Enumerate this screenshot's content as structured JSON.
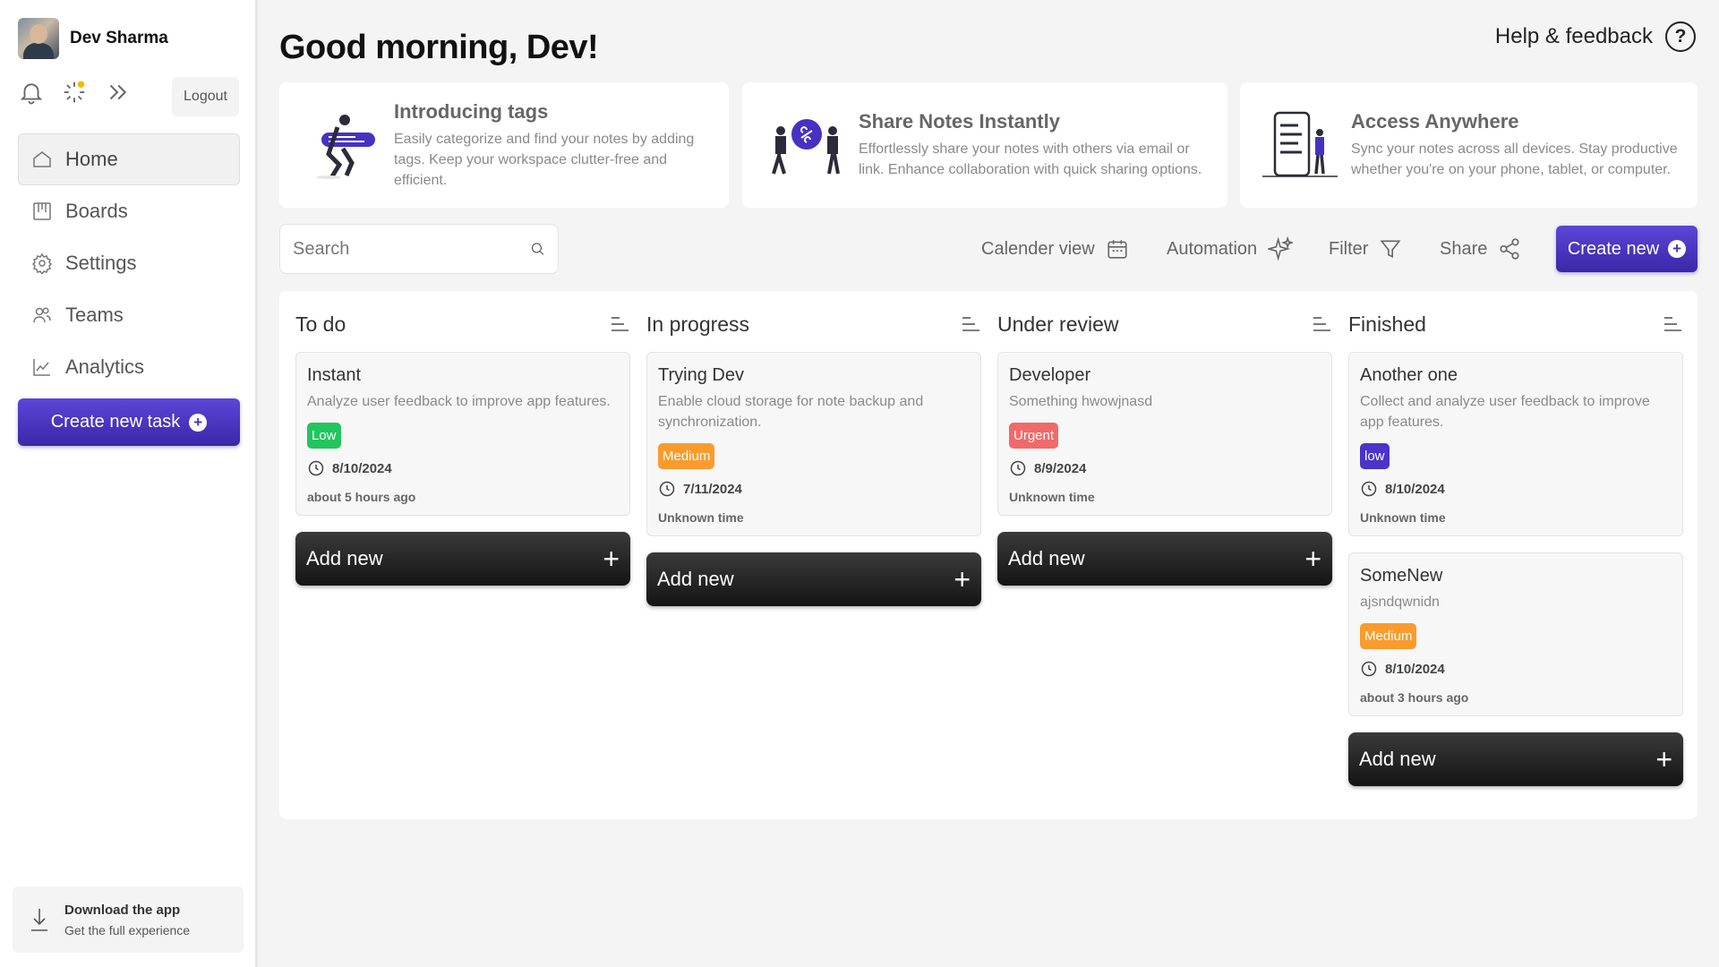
{
  "user": {
    "name": "Dev Sharma"
  },
  "sidebar": {
    "logout_label": "Logout",
    "nav": [
      {
        "label": "Home",
        "icon": "home-icon",
        "active": true
      },
      {
        "label": "Boards",
        "icon": "boards-icon"
      },
      {
        "label": "Settings",
        "icon": "settings-icon"
      },
      {
        "label": "Teams",
        "icon": "teams-icon"
      },
      {
        "label": "Analytics",
        "icon": "analytics-icon"
      }
    ],
    "create_task_label": "Create new task",
    "download": {
      "title": "Download the app",
      "subtitle": "Get the full experience"
    }
  },
  "header": {
    "greeting": "Good morning, Dev!",
    "help_label": "Help & feedback"
  },
  "info_cards": [
    {
      "title": "Introducing tags",
      "desc": "Easily categorize and find your notes by adding tags. Keep your workspace clutter-free and efficient."
    },
    {
      "title": "Share Notes Instantly",
      "desc": "Effortlessly share your notes with others via email or link. Enhance collaboration with quick sharing options."
    },
    {
      "title": "Access Anywhere",
      "desc": "Sync your notes across all devices. Stay productive whether you're on your phone, tablet, or computer."
    }
  ],
  "toolbar": {
    "search_placeholder": "Search",
    "calendar_label": "Calender view",
    "automation_label": "Automation",
    "filter_label": "Filter",
    "share_label": "Share",
    "create_new_label": "Create new"
  },
  "board": {
    "add_new_label": "Add new",
    "columns": [
      {
        "title": "To do",
        "cards": [
          {
            "title": "Instant",
            "desc": "Analyze user feedback to improve app features.",
            "priority": "Low",
            "priority_class": "low",
            "date": "8/10/2024",
            "ago": "about 5 hours ago"
          }
        ]
      },
      {
        "title": "In progress",
        "cards": [
          {
            "title": "Trying Dev",
            "desc": "Enable cloud storage for note backup and synchronization.",
            "priority": "Medium",
            "priority_class": "medium",
            "date": "7/11/2024",
            "ago": "Unknown time"
          }
        ]
      },
      {
        "title": "Under review",
        "cards": [
          {
            "title": "Developer",
            "desc": "Something hwowjnasd",
            "priority": "Urgent",
            "priority_class": "urgent",
            "date": "8/9/2024",
            "ago": "Unknown time"
          }
        ]
      },
      {
        "title": "Finished",
        "cards": [
          {
            "title": "Another one",
            "desc": "Collect and analyze user feedback to improve app features.",
            "priority": "low",
            "priority_class": "lowp",
            "date": "8/10/2024",
            "ago": "Unknown time"
          },
          {
            "title": "SomeNew",
            "desc": "ajsndqwnidn",
            "priority": "Medium",
            "priority_class": "medium",
            "date": "8/10/2024",
            "ago": "about 3 hours ago"
          }
        ]
      }
    ]
  },
  "colors": {
    "accent": "#4632c2",
    "low": "#22c55e",
    "medium": "#fb9b2d",
    "urgent": "#f26969",
    "dark_button": "#1c1c1c"
  }
}
